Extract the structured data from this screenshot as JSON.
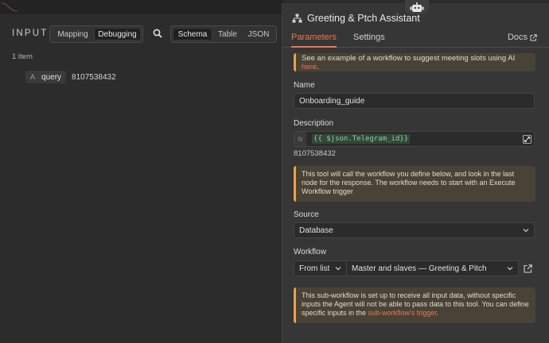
{
  "input_panel": {
    "title": "INPUT",
    "mode_tabs": [
      "Mapping",
      "Debugging"
    ],
    "active_mode": "Debugging",
    "view_tabs": [
      "Schema",
      "Table",
      "JSON"
    ],
    "active_view": "Schema",
    "item_count": "1 item",
    "field": {
      "type_glyph": "A",
      "name": "query",
      "value": "8107538432"
    }
  },
  "node": {
    "title": "Greeting & Ptch Assistant",
    "tabs": [
      "Parameters",
      "Settings"
    ],
    "active_tab": "Parameters",
    "docs_label": "Docs",
    "example_notice_prefix": "See an example of a workflow to suggest meeting slots using AI ",
    "example_notice_link": "here",
    "example_notice_suffix": ".",
    "name_label": "Name",
    "name_value": "Onboarding_guide",
    "description_label": "Description",
    "description_fx": "fx",
    "description_expression": "{{ $json.Telegram_id}}",
    "description_result": "8107538432",
    "tool_notice": "This tool will call the workflow you define below, and look in the last node for the response. The workflow needs to start with an Execute Workflow trigger",
    "source_label": "Source",
    "source_value": "Database",
    "workflow_label": "Workflow",
    "workflow_mode": "From list",
    "workflow_value": "Master and slaves — Greeting & Pitch",
    "subworkflow_notice_prefix": "This sub-workflow is set up to receive all input data, without specific inputs the Agent will not be able to pass data to this tool. You can define specific inputs in the ",
    "subworkflow_notice_link": "sub-workflow's trigger",
    "subworkflow_notice_suffix": "."
  },
  "colors": {
    "accent": "#ea7755",
    "warning_border": "#e8a24a",
    "expression_green": "#7fd79f"
  }
}
